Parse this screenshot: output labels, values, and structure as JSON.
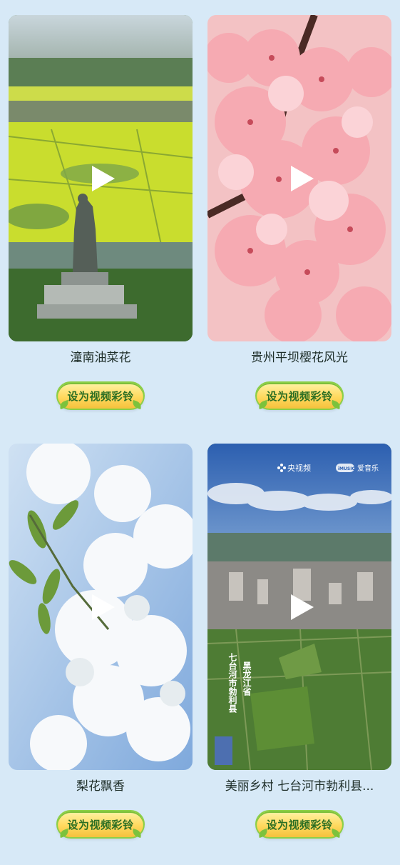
{
  "cards": [
    {
      "title": "潼南油菜花",
      "button_label": "设为视频彩铃"
    },
    {
      "title": "贵州平坝樱花风光",
      "button_label": "设为视频彩铃"
    },
    {
      "title": "梨花飘香",
      "button_label": "设为视频彩铃"
    },
    {
      "title": "美丽乡村 七台河市勃利县...",
      "button_label": "设为视频彩铃",
      "watermark_cctv": "央视频",
      "watermark_music": "爱音乐",
      "watermark_music_badge": "iMUSIC",
      "overlay_text_1": "七台河市勃利县",
      "overlay_text_2": "黑龙江省"
    }
  ],
  "colors": {
    "background": "#d7e9f7",
    "button_fill": "#ffd95e",
    "button_border": "#8ccf47",
    "button_text": "#2b6e23"
  },
  "icons": [
    "play-icon",
    "leaf-icon"
  ]
}
